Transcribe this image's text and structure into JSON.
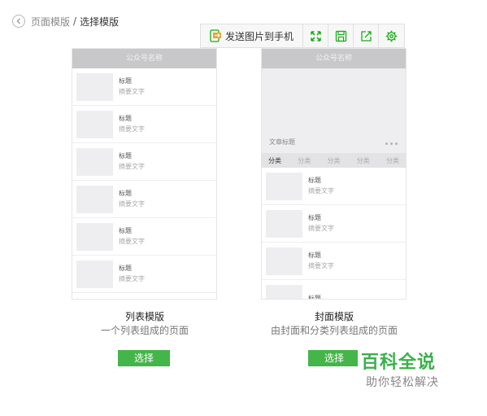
{
  "breadcrumb": {
    "parent": "页面模版",
    "separator": "/",
    "current": "选择模版"
  },
  "toolbar": {
    "send_label": "发送图片到手机",
    "icons": [
      "send-to-phone-icon",
      "fullscreen-icon",
      "save-icon",
      "share-icon",
      "settings-icon"
    ]
  },
  "list_template": {
    "header": "公众号名称",
    "items": [
      {
        "title": "标题",
        "summary": "摘要文字"
      },
      {
        "title": "标题",
        "summary": "摘要文字"
      },
      {
        "title": "标题",
        "summary": "摘要文字"
      },
      {
        "title": "标题",
        "summary": "摘要文字"
      },
      {
        "title": "标题",
        "summary": "摘要文字"
      },
      {
        "title": "标题",
        "summary": "摘要文字"
      }
    ],
    "name": "列表模版",
    "description": "一个列表组成的页面",
    "select_label": "选择"
  },
  "cover_template": {
    "header": "公众号名称",
    "cover_title": "文章标题",
    "categories": [
      "分类",
      "分类",
      "分类",
      "分类",
      "分类"
    ],
    "items": [
      {
        "title": "标题",
        "summary": "摘要文字"
      },
      {
        "title": "标题",
        "summary": "摘要文字"
      },
      {
        "title": "标题",
        "summary": "摘要文字"
      },
      {
        "title": "标题",
        "summary": ""
      }
    ],
    "name": "封面模版",
    "description": "由封面和分类列表组成的页面",
    "select_label": "选择"
  },
  "watermark": {
    "main": "百科全说",
    "sub": "助你轻松解决"
  },
  "colors": {
    "accent_green": "#44b549",
    "toolbar_icon_green": "#1aad19",
    "watermark_green": "#3ab04a",
    "header_gray": "#c8c8ca"
  }
}
